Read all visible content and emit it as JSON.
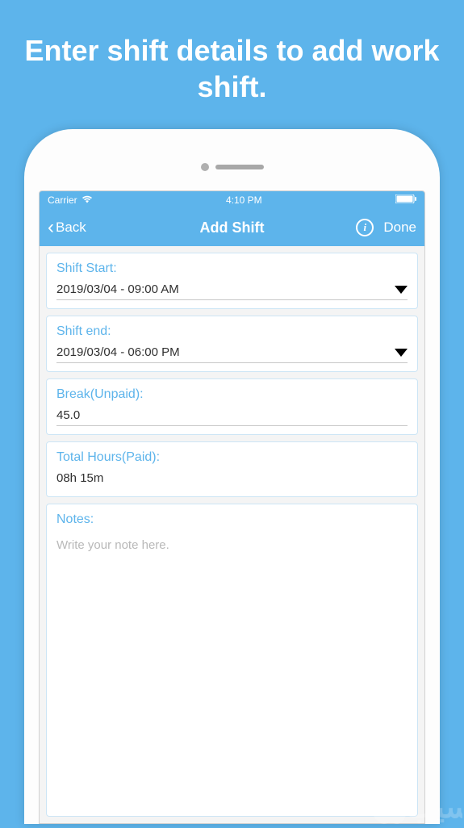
{
  "promo": {
    "title": "Enter shift details to add work shift."
  },
  "statusBar": {
    "carrier": "Carrier",
    "time": "4:10 PM"
  },
  "navBar": {
    "back": "Back",
    "title": "Add Shift",
    "done": "Done"
  },
  "shiftStart": {
    "label": "Shift Start:",
    "value": "2019/03/04 - 09:00 AM"
  },
  "shiftEnd": {
    "label": "Shift end:",
    "value": "2019/03/04 - 06:00 PM"
  },
  "breakUnpaid": {
    "label": "Break(Unpaid):",
    "value": "45.0"
  },
  "totalHours": {
    "label": "Total Hours(Paid):",
    "value": "08h 15m"
  },
  "notes": {
    "label": "Notes:",
    "placeholder": "Write your note here."
  }
}
